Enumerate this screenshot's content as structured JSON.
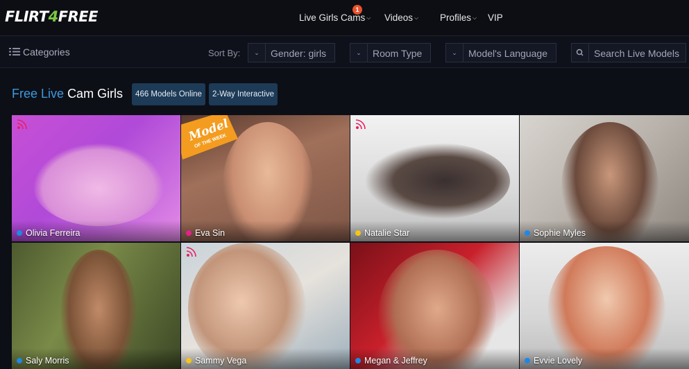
{
  "header": {
    "logo_text_a": "FLIRT",
    "logo_text_b": "4",
    "logo_text_c": "FREE",
    "nav": [
      {
        "label": "Live Girls Cams",
        "badge": "1"
      },
      {
        "label": "Videos"
      },
      {
        "label": "Profiles"
      },
      {
        "label": "VIP"
      }
    ]
  },
  "filters": {
    "categories": "Categories",
    "sort_by": "Sort By:",
    "gender": "Gender: girls",
    "room_type": "Room Type",
    "language": "Model's Language",
    "search_placeholder": "Search Live Models"
  },
  "section": {
    "title_blue": "Free Live",
    "title_white": "Cam Girls",
    "models_online": "466 Models Online",
    "interactive": "2-Way Interactive"
  },
  "badges": {
    "model_of_week_a": "Model",
    "model_of_week_b": "OF THE WEEK"
  },
  "models": [
    {
      "name": "Olivia Ferreira",
      "status_color": "#1e88e5",
      "live_icon": true
    },
    {
      "name": "Eva Sin",
      "status_color": "#e91e8c",
      "live_icon": false
    },
    {
      "name": "Natalie Star",
      "status_color": "#f5c518",
      "live_icon": true
    },
    {
      "name": "Sophie Myles",
      "status_color": "#1e88e5",
      "live_icon": false
    },
    {
      "name": "Saly Morris",
      "status_color": "#1e88e5",
      "live_icon": false
    },
    {
      "name": "Sammy Vega",
      "status_color": "#f5c518",
      "live_icon": true
    },
    {
      "name": "Megan & Jeffrey",
      "status_color": "#1e88e5",
      "live_icon": false
    },
    {
      "name": "Evvie Lovely",
      "status_color": "#1e88e5",
      "live_icon": false
    }
  ],
  "colors": {
    "accent_blue": "#3c9ae0",
    "logo_green": "#7ac943",
    "pill_bg": "#1d3a56",
    "badge": "#e8522b"
  }
}
